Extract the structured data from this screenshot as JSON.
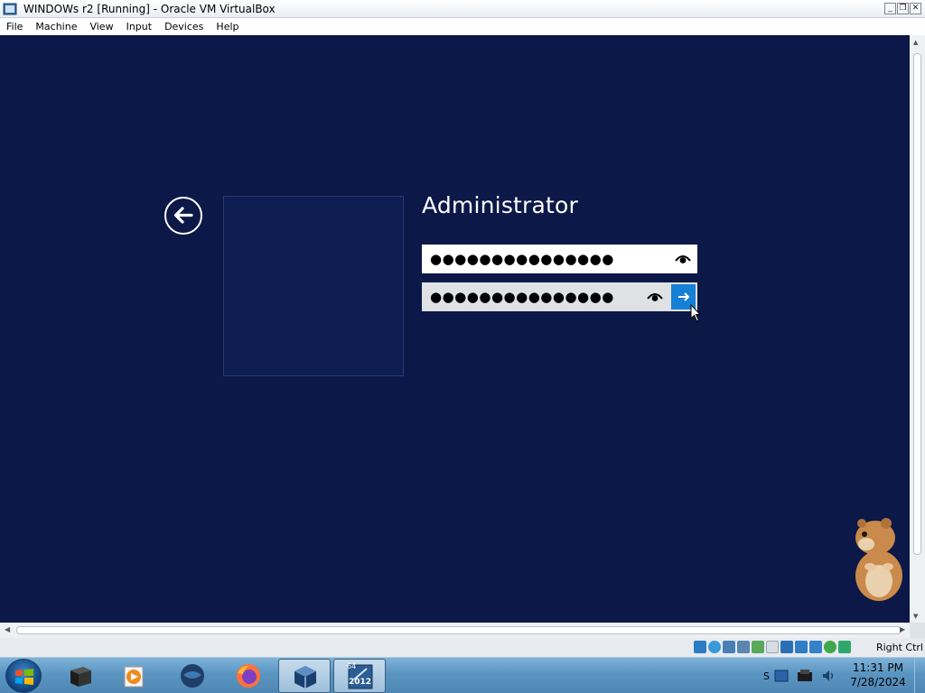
{
  "window": {
    "title": "WINDOWs r2 [Running] - Oracle VM VirtualBox",
    "buttons": {
      "minimize": "_",
      "restore": "❐",
      "close": "✕"
    }
  },
  "menubar": [
    "File",
    "Machine",
    "View",
    "Input",
    "Devices",
    "Help"
  ],
  "login": {
    "user_name": "Administrator",
    "new_password": "●●●●●●●●●●●●●●●",
    "confirm_password": "●●●●●●●●●●●●●●●",
    "back_icon": "back-arrow-icon",
    "submit_icon": "arrow-right-icon",
    "reveal_icon": "eye-icon"
  },
  "statusbar": {
    "host_key": "Right Ctrl",
    "icons": [
      "hard-disk-icon",
      "optical-drive-icon",
      "audio-icon",
      "network-icon",
      "usb-icon",
      "shared-folders-icon",
      "display-icon",
      "recording-icon",
      "cpu-icon",
      "mouse-integration-icon",
      "keyboard-icon"
    ]
  },
  "taskbar": {
    "apps": [
      "black-box-app-icon",
      "media-player-icon",
      "globe-app-icon",
      "firefox-icon",
      "virtualbox-icon",
      "windows-server-2012-icon"
    ],
    "server_badge": "2012",
    "server_bits": "64",
    "tray_letter": "S",
    "clock_time": "11:31 PM",
    "clock_date": "7/28/2024"
  },
  "colors": {
    "guest_background": "#0b1848",
    "submit_button": "#1580d6",
    "taskbar": "#5a95c2"
  }
}
